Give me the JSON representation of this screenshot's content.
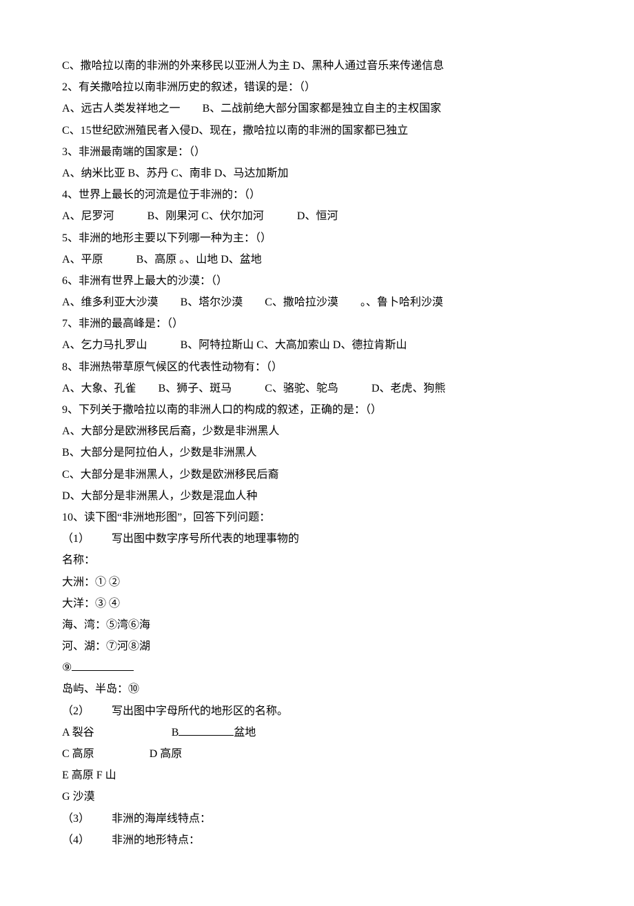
{
  "q_pre_c": "C、撒哈拉以南的非洲的外来移民以亚洲人为主 D、黑种人通过音乐来传递信息",
  "q2": {
    "stem": "2、有关撒哈拉以南非洲历史的叙述，错误的是：（）",
    "a": "A、远古人类发祥地之一",
    "b": "B、二战前绝大部分国家都是独立自主的主权国家",
    "c": "C、15世纪欧洲殖民者入侵",
    "d": "D、现在，撒哈拉以南的非洲的国家都已独立"
  },
  "q3": {
    "stem": "3、非洲最南端的国家是：（）",
    "a": "A、纳米比亚 B、苏丹 C、南非 D、马达加斯加"
  },
  "q4": {
    "stem": "4、世界上最长的河流是位于非洲的：（）",
    "a": "A、尼罗河",
    "b": "B、刚果河 C、伏尔加河",
    "d": "D、恒河"
  },
  "q5": {
    "stem": "5、非洲的地形主要以下列哪一种为主：（）",
    "a": "A、平原",
    "b": "B、高原 。、山地 D、盆地"
  },
  "q6": {
    "stem": "6、非洲有世界上最大的沙漠：（）",
    "a": "A、维多利亚大沙漠",
    "b": "B、塔尔沙漠",
    "c": "C、撒哈拉沙漠",
    "d": "。、鲁卜哈利沙漠"
  },
  "q7": {
    "stem": "7、非洲的最高峰是：（）",
    "a": "A、乞力马扎罗山",
    "b": "B、阿特拉斯山 C、大高加索山 D、德拉肯斯山"
  },
  "q8": {
    "stem": "8、非洲热带草原气候区的代表性动物有：（）",
    "a": "A、大象、孔雀",
    "b": "B、狮子、斑马",
    "c": "C、骆驼、鸵鸟",
    "d": "D、老虎、狗熊"
  },
  "q9": {
    "stem": "9、下列关于撒哈拉以南的非洲人口的构成的叙述，正确的是：（）",
    "a": "A、大部分是欧洲移民后裔，少数是非洲黑人",
    "b": "B、大部分是阿拉伯人，少数是非洲黑人",
    "c": "C、大部分是非洲黑人，少数是欧洲移民后裔",
    "d": "D、大部分是非洲黑人，少数是混血人种"
  },
  "q10": {
    "stem": "10、读下图“非洲地形图”，回答下列问题：",
    "p1a": "（1）",
    "p1b": "写出图中数字序号所代表的地理事物的",
    "p1c": "名称：",
    "continent": "大洲：① ②",
    "ocean": "大洋：③ ④",
    "sea": "海、湾：⑤湾⑥海",
    "river": "河、湖：⑦河⑧湖",
    "nine": "⑨",
    "island": "岛屿、半岛：⑩",
    "p2a": "（2）",
    "p2b": "写出图中字母所代的地形区的名称。",
    "la": "A 裂谷",
    "lb_pre": "B",
    "lb_suf": "盆地",
    "lc": "C 高原",
    "ld": "D 高原",
    "le": "E 高原 F 山",
    "lg": "G 沙漠",
    "p3a": "（3）",
    "p3b": "非洲的海岸线特点：",
    "p4a": "（4）",
    "p4b": "非洲的地形特点："
  }
}
